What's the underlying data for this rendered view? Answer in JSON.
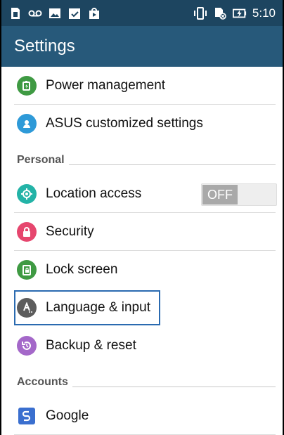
{
  "status_bar": {
    "left_icons": [
      "sim-card-icon",
      "voicemail-icon",
      "image-icon",
      "checklist-icon",
      "play-store-icon"
    ],
    "right_icons": [
      "vibrate-icon",
      "no-sim-icon",
      "battery-charging-icon"
    ],
    "time": "5:10"
  },
  "app_bar": {
    "title": "Settings"
  },
  "items": [
    {
      "kind": "row",
      "label": "Power management",
      "icon": "power-management-icon",
      "color": "#3f9a43"
    },
    {
      "kind": "row",
      "label": "ASUS customized settings",
      "icon": "asus-settings-icon",
      "color": "#2e9ad8"
    },
    {
      "kind": "section",
      "label": "Personal"
    },
    {
      "kind": "row",
      "label": "Location access",
      "icon": "location-icon",
      "color": "#23b3a7",
      "toggle": "OFF"
    },
    {
      "kind": "row",
      "label": "Security",
      "icon": "lock-icon",
      "color": "#e6466e"
    },
    {
      "kind": "row",
      "label": "Lock screen",
      "icon": "lock-screen-icon",
      "color": "#3f9a43"
    },
    {
      "kind": "row",
      "label": "Language & input",
      "icon": "language-icon",
      "color": "#5c5c5c",
      "focused": true
    },
    {
      "kind": "row",
      "label": "Backup & reset",
      "icon": "backup-icon",
      "color": "#a468c9"
    },
    {
      "kind": "section",
      "label": "Accounts"
    },
    {
      "kind": "row",
      "label": "Google",
      "icon": "google-icon",
      "color": "#3a6fcf"
    }
  ],
  "colors": {
    "status_bar": "#1d4560",
    "app_bar": "#27597a",
    "focus": "#2a6ab0"
  }
}
